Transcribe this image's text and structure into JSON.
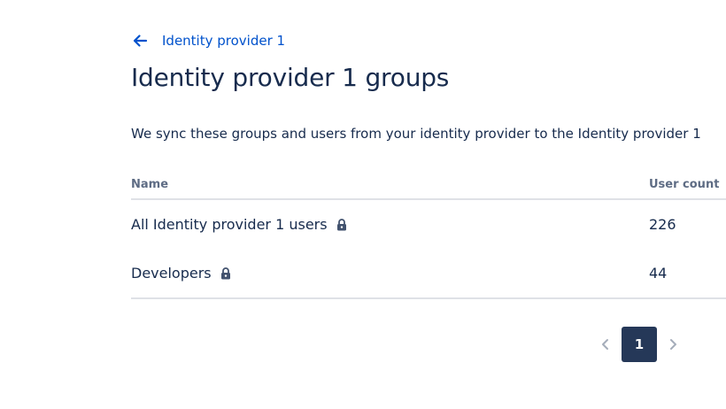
{
  "header": {
    "back_label": "Identity provider 1",
    "title": "Identity provider 1 groups"
  },
  "description": "We sync these groups and users from your identity provider to the Identity provider 1",
  "table": {
    "columns": [
      "Name",
      "User count"
    ],
    "rows": [
      {
        "name": "All Identity provider 1 users",
        "count": "226"
      },
      {
        "name": "Developers",
        "count": "44"
      }
    ]
  },
  "pagination": {
    "current_page": "1",
    "pages": [
      "1"
    ]
  },
  "colors": {
    "link": "#0052cc",
    "text": "#172b4d",
    "header_text": "#5e6c84",
    "selected_page_bg": "#253858",
    "divider": "#dfe1e6"
  },
  "icons": [
    "arrow-left-icon",
    "lock-icon",
    "chevron-left-icon",
    "chevron-right-icon"
  ]
}
